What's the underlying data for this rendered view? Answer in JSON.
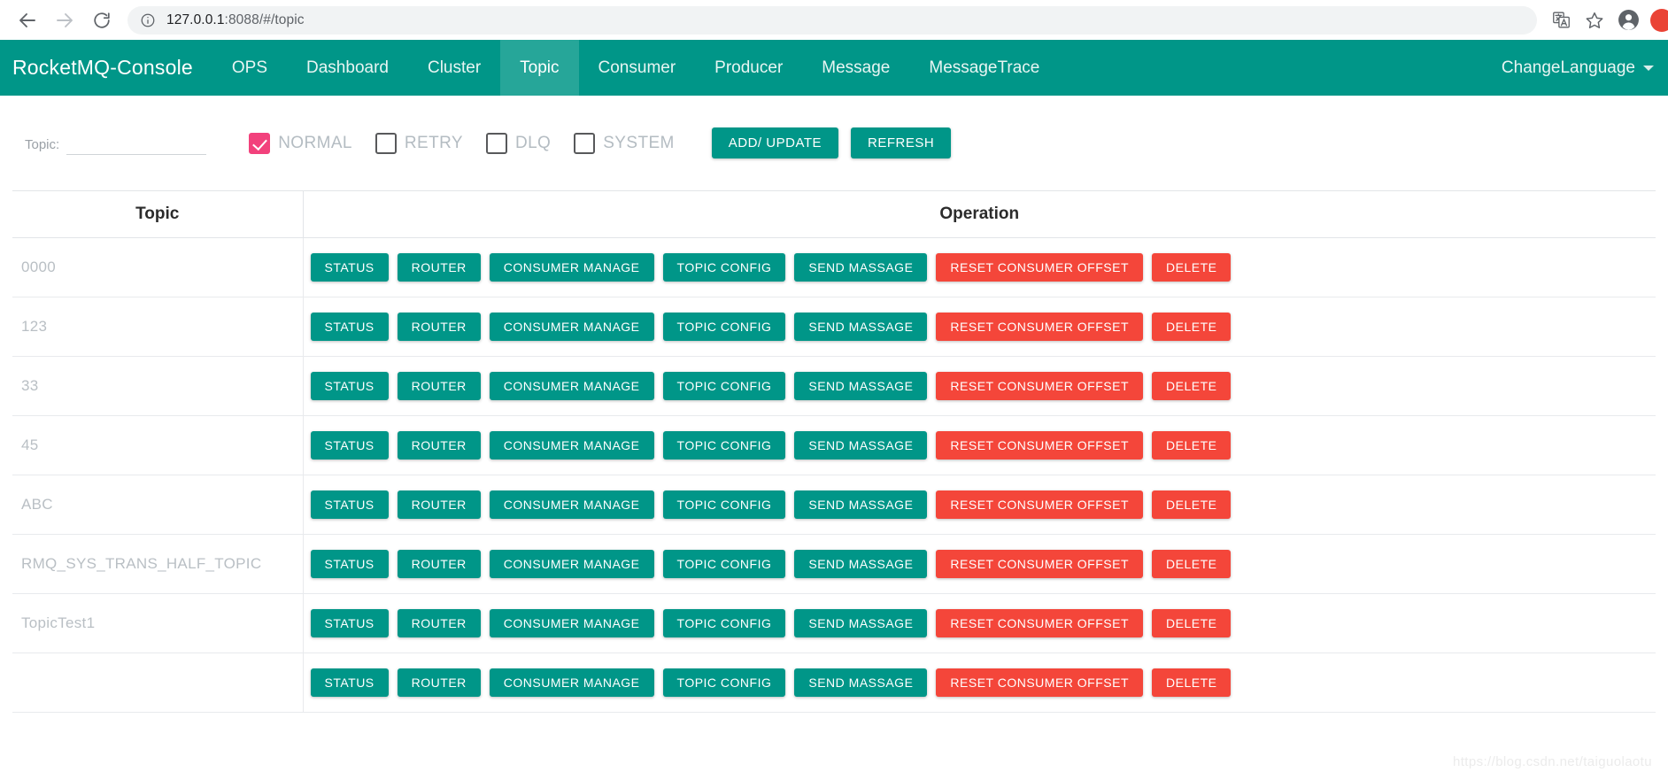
{
  "browser": {
    "back_icon": "back-arrow-icon",
    "forward_icon": "forward-arrow-icon",
    "reload_icon": "reload-icon",
    "site_info_icon": "site-info-icon",
    "url_host": "127.0.0.1",
    "url_rest": ":8088/#/topic",
    "url_full": "127.0.0.1:8088/#/topic",
    "translate_icon": "translate-icon",
    "bookmark_icon": "star-bookmark-icon",
    "profile_icon": "profile-avatar-icon",
    "extension_icon": "red-circle-extension-icon"
  },
  "header": {
    "brand": "RocketMQ-Console",
    "nav_items": [
      {
        "label": "OPS",
        "active": false
      },
      {
        "label": "Dashboard",
        "active": false
      },
      {
        "label": "Cluster",
        "active": false
      },
      {
        "label": "Topic",
        "active": true
      },
      {
        "label": "Consumer",
        "active": false
      },
      {
        "label": "Producer",
        "active": false
      },
      {
        "label": "Message",
        "active": false
      },
      {
        "label": "MessageTrace",
        "active": false
      }
    ],
    "language_menu": "ChangeLanguage",
    "accent_color": "#009688",
    "active_tab_color": "#26a699"
  },
  "filters": {
    "topic_label": "Topic:",
    "topic_value": "",
    "topic_placeholder": "",
    "checkboxes": [
      {
        "label": "NORMAL",
        "checked": true
      },
      {
        "label": "RETRY",
        "checked": false
      },
      {
        "label": "DLQ",
        "checked": false
      },
      {
        "label": "SYSTEM",
        "checked": false
      }
    ],
    "checked_color": "#f2417c",
    "add_update_label": "ADD/ UPDATE",
    "refresh_label": "REFRESH"
  },
  "table": {
    "columns": [
      "Topic",
      "Operation"
    ],
    "operation_buttons": [
      {
        "label": "STATUS",
        "style": "teal"
      },
      {
        "label": "ROUTER",
        "style": "teal"
      },
      {
        "label": "CONSUMER MANAGE",
        "style": "teal"
      },
      {
        "label": "TOPIC CONFIG",
        "style": "teal"
      },
      {
        "label": "SEND MASSAGE",
        "style": "teal"
      },
      {
        "label": "RESET CONSUMER OFFSET",
        "style": "red"
      },
      {
        "label": "DELETE",
        "style": "red"
      }
    ],
    "rows": [
      {
        "topic": "0000"
      },
      {
        "topic": "123"
      },
      {
        "topic": "33"
      },
      {
        "topic": "45"
      },
      {
        "topic": "ABC"
      },
      {
        "topic": "RMQ_SYS_TRANS_HALF_TOPIC"
      },
      {
        "topic": "TopicTest1"
      },
      {
        "topic": ""
      }
    ],
    "teal_color": "#009688",
    "red_color": "#f4463a"
  },
  "watermark": "https://blog.csdn.net/taiguolaotu"
}
